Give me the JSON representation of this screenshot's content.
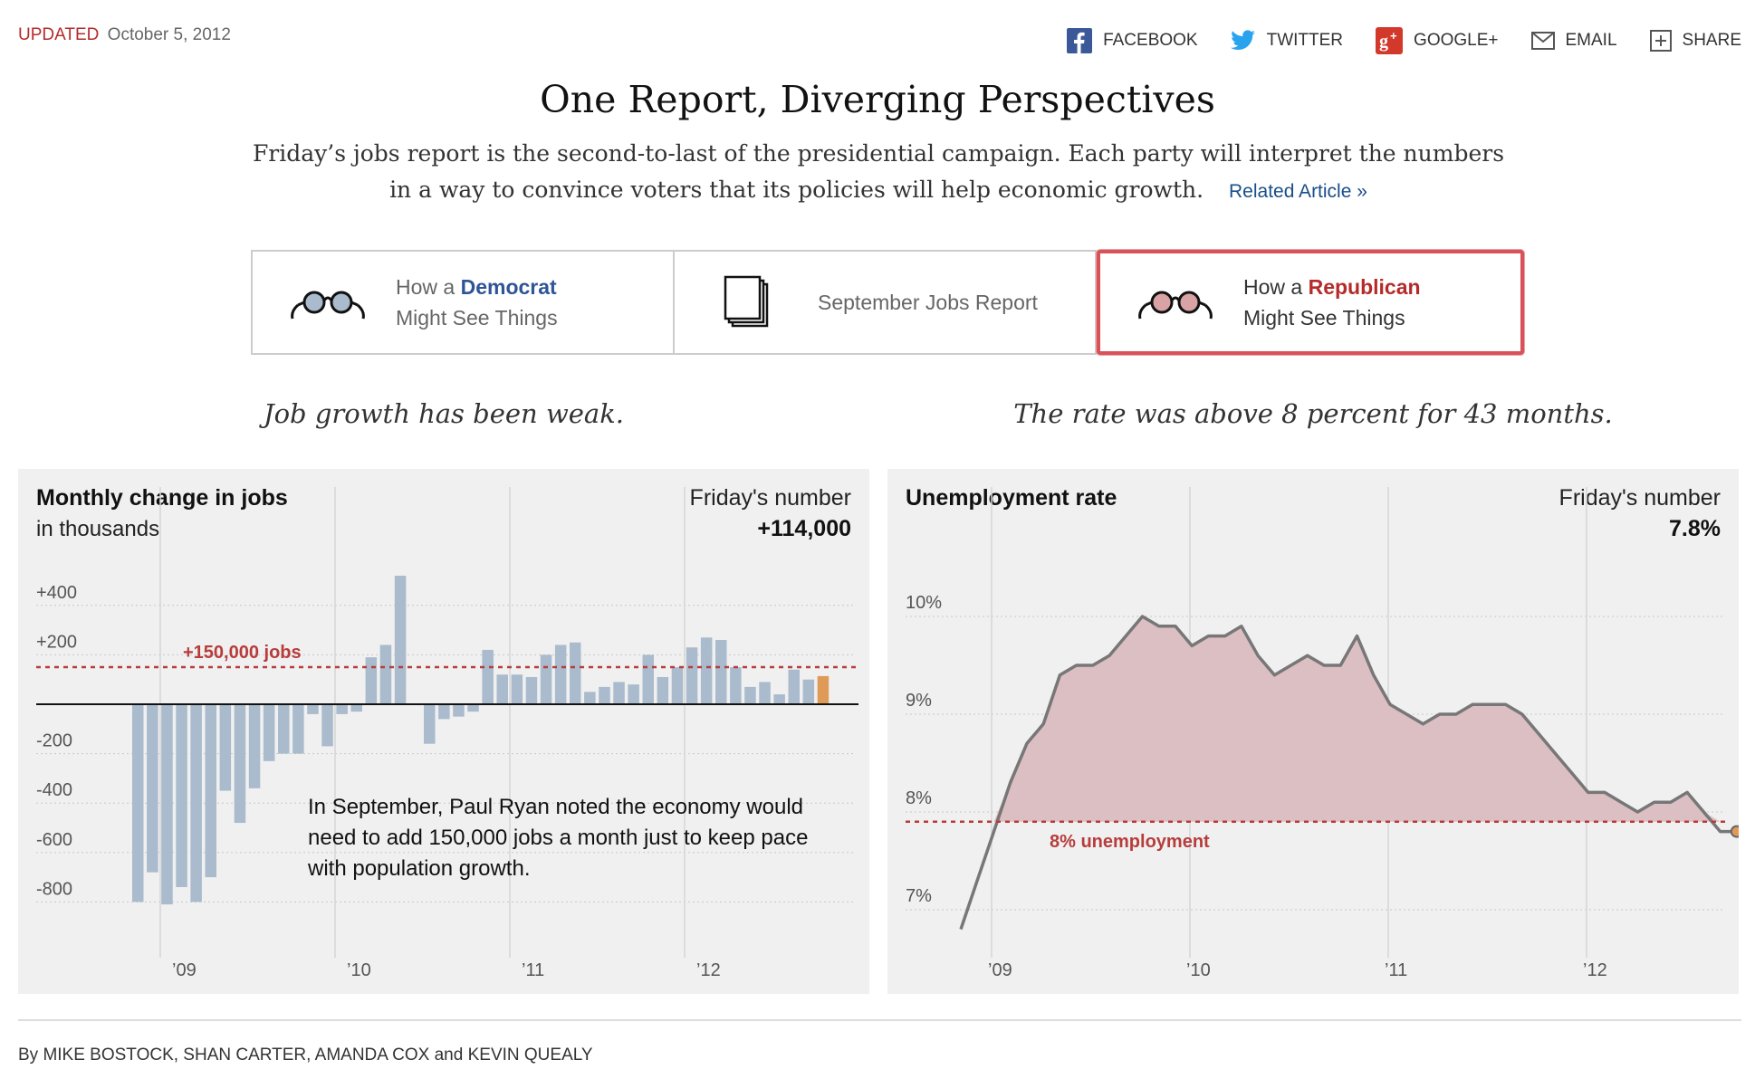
{
  "header": {
    "updated_label": "UPDATED",
    "updated_date": "October 5, 2012",
    "share": [
      {
        "label": "FACEBOOK",
        "icon": "facebook-icon"
      },
      {
        "label": "TWITTER",
        "icon": "twitter-icon"
      },
      {
        "label": "GOOGLE+",
        "icon": "google-plus-icon"
      },
      {
        "label": "EMAIL",
        "icon": "email-icon"
      },
      {
        "label": "SHARE",
        "icon": "share-icon"
      }
    ]
  },
  "headline": "One Report, Diverging Perspectives",
  "dek": "Friday’s jobs report is the second-to-last of the presidential campaign. Each party will interpret the numbers in a way to convince voters that its policies will help economic growth.",
  "related_link": "Related Article »",
  "tabs": [
    {
      "prefix": "How a",
      "party": "Democrat",
      "line2": "Might See Things"
    },
    {
      "label": "September Jobs Report"
    },
    {
      "prefix": "How a",
      "party": "Republican",
      "line2": "Might See Things"
    }
  ],
  "kickers": {
    "left": "Job growth has been weak.",
    "right": "The rate was above 8 percent for 43 months."
  },
  "colors": {
    "bar": "#a9bbcc",
    "bar_latest": "#e09a57",
    "reference": "#b83c3c",
    "area_fill": "#dcbfc2",
    "line": "#777777",
    "panel_bg": "#f0f0f0",
    "democrat": "#2f5597",
    "republican": "#b52b2b"
  },
  "chart_data": [
    {
      "type": "bar",
      "title": "Monthly change in jobs",
      "subtitle": "in thousands",
      "highlight_label": "Friday's number",
      "highlight_value": "+114,000",
      "x_ticks": [
        "’09",
        "’10",
        "’11",
        "’12"
      ],
      "y_ticks": [
        "+400",
        "+200",
        "-200",
        "-400",
        "-600",
        "-800"
      ],
      "ylim": [
        -850,
        460
      ],
      "reference_line": {
        "value": 150,
        "label": "+150,000 jobs"
      },
      "annotation": "In September, Paul Ryan noted the economy would need to add 150,000 jobs a month just to keep pace with population growth.",
      "months": [
        "2008-10",
        "2008-11",
        "2008-12",
        "2009-01",
        "2009-02",
        "2009-03",
        "2009-04",
        "2009-05",
        "2009-06",
        "2009-07",
        "2009-08",
        "2009-09",
        "2009-10",
        "2009-11",
        "2009-12",
        "2010-01",
        "2010-02",
        "2010-03",
        "2010-04",
        "2010-05",
        "2010-06",
        "2010-07",
        "2010-08",
        "2010-09",
        "2010-10",
        "2010-11",
        "2010-12",
        "2011-01",
        "2011-02",
        "2011-03",
        "2011-04",
        "2011-05",
        "2011-06",
        "2011-07",
        "2011-08",
        "2011-09",
        "2011-10",
        "2011-12",
        "2011-12b",
        "2012-01",
        "2012-02",
        "2012-03",
        "2012-04",
        "2012-05",
        "2012-06",
        "2012-07",
        "2012-08",
        "2012-09"
      ],
      "values": [
        -800,
        -680,
        -810,
        -740,
        -800,
        -700,
        -350,
        -480,
        -340,
        -230,
        -200,
        -200,
        -40,
        -170,
        -40,
        -30,
        190,
        240,
        520,
        0,
        -160,
        -60,
        -50,
        -30,
        220,
        120,
        120,
        110,
        200,
        240,
        250,
        50,
        70,
        90,
        80,
        200,
        110,
        150,
        230,
        270,
        260,
        150,
        70,
        90,
        40,
        140,
        100,
        114
      ],
      "latest_index": 47
    },
    {
      "type": "area",
      "title": "Unemployment rate",
      "highlight_label": "Friday's number",
      "highlight_value": "7.8%",
      "x_ticks": [
        "’09",
        "’10",
        "’11",
        "’12"
      ],
      "y_ticks": [
        "10%",
        "9%",
        "8%",
        "7%"
      ],
      "ylim": [
        6.6,
        10.2
      ],
      "reference_line": {
        "value": 7.9,
        "label": "8% unemployment"
      },
      "x": [
        "2008-10",
        "2008-11",
        "2008-12",
        "2009-01",
        "2009-02",
        "2009-03",
        "2009-04",
        "2009-05",
        "2009-06",
        "2009-07",
        "2009-08",
        "2009-09",
        "2009-10",
        "2009-11",
        "2009-12",
        "2010-01",
        "2010-02",
        "2010-03",
        "2010-04",
        "2010-05",
        "2010-06",
        "2010-07",
        "2010-08",
        "2010-09",
        "2010-10",
        "2010-11",
        "2010-12",
        "2011-01",
        "2011-02",
        "2011-03",
        "2011-04",
        "2011-05",
        "2011-06",
        "2011-07",
        "2011-08",
        "2011-09",
        "2011-10",
        "2011-11",
        "2011-12",
        "2012-01",
        "2012-02",
        "2012-03",
        "2012-04",
        "2012-05",
        "2012-06",
        "2012-07",
        "2012-08",
        "2012-09"
      ],
      "values": [
        6.8,
        7.3,
        7.8,
        8.3,
        8.7,
        8.9,
        9.4,
        9.5,
        9.5,
        9.6,
        9.8,
        10.0,
        9.9,
        9.9,
        9.7,
        9.8,
        9.8,
        9.9,
        9.6,
        9.4,
        9.5,
        9.6,
        9.5,
        9.5,
        9.8,
        9.4,
        9.1,
        9.0,
        8.9,
        9.0,
        9.0,
        9.1,
        9.1,
        9.1,
        9.0,
        8.8,
        8.6,
        8.4,
        8.2,
        8.2,
        8.1,
        8.0,
        8.1,
        8.1,
        8.2,
        8.0,
        7.8,
        7.8
      ],
      "latest_value": 7.8
    }
  ],
  "byline": "By MIKE BOSTOCK, SHAN CARTER, AMANDA COX and KEVIN QUEALY"
}
